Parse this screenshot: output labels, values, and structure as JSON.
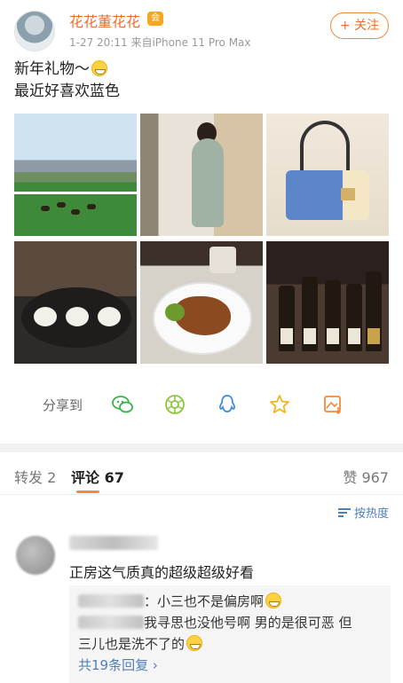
{
  "post": {
    "username": "花花董花花",
    "badge": "会",
    "meta": "1-27 20:11  来自iPhone 11 Pro Max",
    "follow_label": "+ 关注",
    "text_line1": "新年礼物～",
    "text_line2": "最近好喜欢蓝色",
    "images": [
      {
        "icon": "racecourse-photo"
      },
      {
        "icon": "boutique-photo"
      },
      {
        "icon": "handbag-photo"
      },
      {
        "icon": "dessert-photo"
      },
      {
        "icon": "dish-photo"
      },
      {
        "icon": "wine-photo"
      }
    ]
  },
  "share": {
    "label": "分享到",
    "targets": [
      "wechat",
      "moments",
      "qq",
      "favorite",
      "image"
    ]
  },
  "tabs": {
    "repost": "转发 2",
    "comments": "评论 67",
    "likes": "赞 967"
  },
  "sort": {
    "label": "按热度"
  },
  "comment": {
    "text": "正房这气质真的超级超级好看",
    "reply1": "：小三也不是偏房啊",
    "reply2_part1": "我寻思也没他号啊 男的是很可恶 但",
    "reply2_part2": "三儿也是洗不了的",
    "more_replies": "共19条回复 ›"
  },
  "colors": {
    "accent": "#e8702a",
    "link": "#4f7fb8"
  }
}
